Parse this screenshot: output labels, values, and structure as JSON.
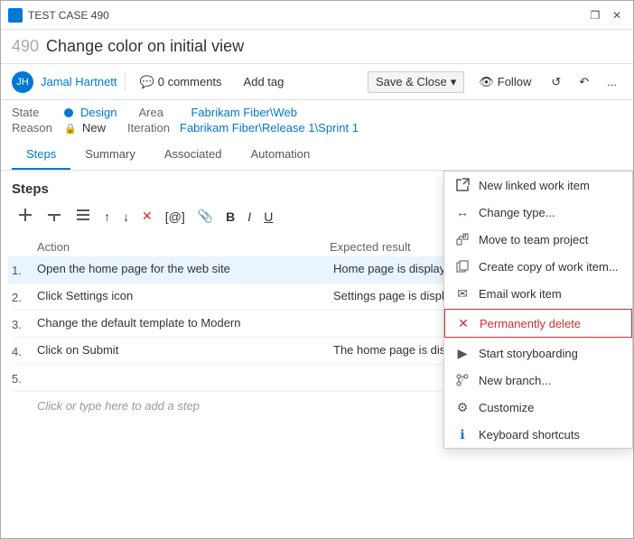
{
  "window": {
    "title": "TEST CASE 490",
    "close_label": "✕",
    "restore_label": "❐"
  },
  "work_item": {
    "id": "490",
    "name": "Change color on initial view"
  },
  "toolbar": {
    "user": "Jamal Hartnett",
    "comments_label": "0 comments",
    "add_tag_label": "Add tag",
    "save_label": "Save & Close",
    "follow_label": "Follow",
    "more_label": "..."
  },
  "fields": {
    "state_label": "State",
    "state_value": "Design",
    "area_label": "Area",
    "area_value": "Fabrikam Fiber\\Web",
    "reason_label": "Reason",
    "reason_value": "New",
    "iteration_label": "Iteration",
    "iteration_value": "Fabrikam Fiber\\Release 1\\Sprint 1"
  },
  "tabs": [
    {
      "id": "steps",
      "label": "Steps",
      "active": true
    },
    {
      "id": "summary",
      "label": "Summary",
      "active": false
    },
    {
      "id": "associated",
      "label": "Associated",
      "active": false
    },
    {
      "id": "automation",
      "label": "Automation",
      "active": false
    }
  ],
  "steps_section": {
    "heading": "Steps",
    "col_action": "Action",
    "col_result": "Expected result",
    "steps": [
      {
        "num": "1.",
        "action": "Open the home page for the web site",
        "result": "Home page is displayed",
        "highlight": true
      },
      {
        "num": "2.",
        "action": "Click Settings icon",
        "result": "Settings page is displayed",
        "highlight": false
      },
      {
        "num": "3.",
        "action": "Change the default template to Modern",
        "result": "",
        "highlight": false
      },
      {
        "num": "4.",
        "action": "Click on Submit",
        "result": "The home page is displayed with the Modern look",
        "highlight": false
      },
      {
        "num": "5.",
        "action": "",
        "result": "",
        "highlight": false
      }
    ],
    "add_hint": "Click or type here to add a step"
  },
  "dropdown_menu": {
    "items": [
      {
        "id": "new-linked",
        "icon": "🔗",
        "label": "New linked work item",
        "danger": false
      },
      {
        "id": "change-type",
        "icon": "↔",
        "label": "Change type...",
        "danger": false
      },
      {
        "id": "move-team",
        "icon": "⬆",
        "label": "Move to team project",
        "danger": false
      },
      {
        "id": "create-copy",
        "icon": "📋",
        "label": "Create copy of work item...",
        "danger": false
      },
      {
        "id": "email",
        "icon": "✉",
        "label": "Email work item",
        "danger": false
      },
      {
        "id": "perm-delete",
        "icon": "✕",
        "label": "Permanently delete",
        "danger": true
      },
      {
        "id": "storyboard",
        "icon": "▶",
        "label": "Start storyboarding",
        "danger": false
      },
      {
        "id": "new-branch",
        "icon": "⎇",
        "label": "New branch...",
        "danger": false
      },
      {
        "id": "customize",
        "icon": "⚙",
        "label": "Customize",
        "danger": false
      },
      {
        "id": "keyboard",
        "icon": "ℹ",
        "label": "Keyboard shortcuts",
        "danger": false
      }
    ]
  }
}
